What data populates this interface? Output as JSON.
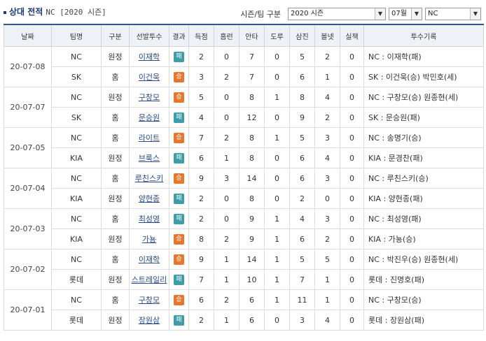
{
  "header": {
    "section_title": "상대 전적",
    "subtitle": "NC [2020 시즌]",
    "filter_label": "시즌/팀 구분",
    "season_select": "2020 시즌",
    "month_select": "07월",
    "team_select": "NC"
  },
  "columns": [
    "날짜",
    "팀명",
    "구분",
    "선발투수",
    "결과",
    "득점",
    "홈런",
    "안타",
    "도루",
    "삼진",
    "볼넷",
    "실책",
    "투수기록"
  ],
  "games": [
    {
      "date": "20-07-08",
      "rows": [
        {
          "team": "NC",
          "type": "원정",
          "pitcher": "이재학",
          "result": "패",
          "result_kind": "loss",
          "r": "2",
          "hr": "0",
          "h": "7",
          "sb": "0",
          "so": "5",
          "bb": "2",
          "e": "0",
          "record": "NC : 이재학(패)"
        },
        {
          "team": "SK",
          "type": "홈",
          "pitcher": "이건욱",
          "result": "승",
          "result_kind": "win",
          "r": "3",
          "hr": "2",
          "h": "7",
          "sb": "0",
          "so": "6",
          "bb": "1",
          "e": "0",
          "record": "SK : 이건욱(승) 박민호(세)"
        }
      ]
    },
    {
      "date": "20-07-07",
      "rows": [
        {
          "team": "NC",
          "type": "원정",
          "pitcher": "구창모",
          "result": "승",
          "result_kind": "win",
          "r": "5",
          "hr": "0",
          "h": "8",
          "sb": "1",
          "so": "8",
          "bb": "4",
          "e": "0",
          "record": "NC : 구창모(승) 원종현(세)"
        },
        {
          "team": "SK",
          "type": "홈",
          "pitcher": "문승원",
          "result": "패",
          "result_kind": "loss",
          "r": "4",
          "hr": "0",
          "h": "12",
          "sb": "0",
          "so": "9",
          "bb": "2",
          "e": "0",
          "record": "SK : 문승원(패)"
        }
      ]
    },
    {
      "date": "20-07-05",
      "rows": [
        {
          "team": "NC",
          "type": "홈",
          "pitcher": "라이트",
          "result": "승",
          "result_kind": "win",
          "r": "7",
          "hr": "2",
          "h": "8",
          "sb": "1",
          "so": "5",
          "bb": "3",
          "e": "0",
          "record": "NC : 송명기(승)"
        },
        {
          "team": "KIA",
          "type": "원정",
          "pitcher": "브룩스",
          "result": "패",
          "result_kind": "loss",
          "r": "6",
          "hr": "1",
          "h": "8",
          "sb": "0",
          "so": "6",
          "bb": "4",
          "e": "0",
          "record": "KIA : 문경찬(패)"
        }
      ]
    },
    {
      "date": "20-07-04",
      "rows": [
        {
          "team": "NC",
          "type": "홈",
          "pitcher": "루친스키",
          "result": "승",
          "result_kind": "win",
          "r": "9",
          "hr": "3",
          "h": "14",
          "sb": "0",
          "so": "6",
          "bb": "3",
          "e": "0",
          "record": "NC : 루친스키(승)"
        },
        {
          "team": "KIA",
          "type": "원정",
          "pitcher": "양현종",
          "result": "패",
          "result_kind": "loss",
          "r": "2",
          "hr": "0",
          "h": "8",
          "sb": "0",
          "so": "2",
          "bb": "0",
          "e": "0",
          "record": "KIA : 양현종(패)"
        }
      ]
    },
    {
      "date": "20-07-03",
      "rows": [
        {
          "team": "NC",
          "type": "홈",
          "pitcher": "최성영",
          "result": "패",
          "result_kind": "loss",
          "r": "2",
          "hr": "0",
          "h": "9",
          "sb": "1",
          "so": "4",
          "bb": "3",
          "e": "0",
          "record": "NC : 최성영(패)"
        },
        {
          "team": "KIA",
          "type": "원정",
          "pitcher": "가뇽",
          "result": "승",
          "result_kind": "win",
          "r": "8",
          "hr": "2",
          "h": "9",
          "sb": "1",
          "so": "6",
          "bb": "2",
          "e": "0",
          "record": "KIA : 가뇽(승)"
        }
      ]
    },
    {
      "date": "20-07-02",
      "rows": [
        {
          "team": "NC",
          "type": "홈",
          "pitcher": "이재학",
          "result": "승",
          "result_kind": "win",
          "r": "9",
          "hr": "1",
          "h": "14",
          "sb": "1",
          "so": "5",
          "bb": "5",
          "e": "0",
          "record": "NC : 박진우(승) 원종현(세)"
        },
        {
          "team": "롯데",
          "type": "원정",
          "pitcher": "스트레일리",
          "result": "패",
          "result_kind": "loss",
          "r": "7",
          "hr": "1",
          "h": "10",
          "sb": "1",
          "so": "7",
          "bb": "1",
          "e": "0",
          "record": "롯데 : 진명호(패)"
        }
      ]
    },
    {
      "date": "20-07-01",
      "rows": [
        {
          "team": "NC",
          "type": "홈",
          "pitcher": "구창모",
          "result": "승",
          "result_kind": "win",
          "r": "6",
          "hr": "2",
          "h": "6",
          "sb": "1",
          "so": "11",
          "bb": "1",
          "e": "0",
          "record": "NC : 구창모(승)"
        },
        {
          "team": "롯데",
          "type": "원정",
          "pitcher": "장원삼",
          "result": "패",
          "result_kind": "loss",
          "r": "2",
          "hr": "1",
          "h": "6",
          "sb": "0",
          "so": "3",
          "bb": "4",
          "e": "0",
          "record": "롯데 : 장원삼(패)"
        }
      ]
    }
  ],
  "colors": {
    "win": "#e8762d",
    "loss": "#3f9da8",
    "header_line": "#35588c"
  }
}
